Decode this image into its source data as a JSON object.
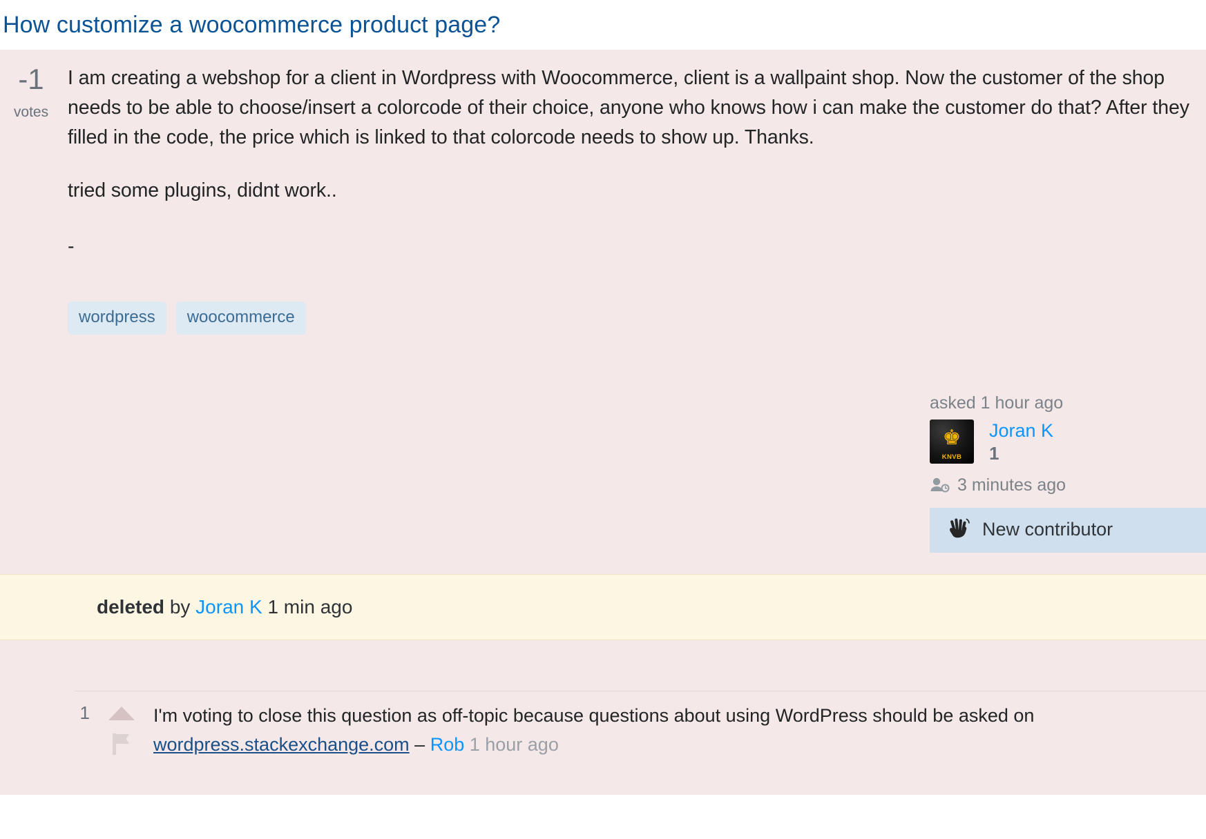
{
  "question": {
    "title": "How customize a woocommerce product page?",
    "votes": "-1",
    "votes_label": "votes",
    "body_paragraphs": [
      "I am creating a webshop for a client in Wordpress with Woocommerce, client is a wallpaint shop. Now the customer of the shop needs to be able to choose/insert a colorcode of their choice, anyone who knows how i can make the customer do that? After they filled in the code, the price which is linked to that colorcode needs to show up. Thanks.",
      "tried some plugins, didnt work..",
      "-"
    ],
    "tags": [
      "wordpress",
      "woocommerce"
    ]
  },
  "user_card": {
    "asked_line": "asked 1 hour ago",
    "avatar_icon": "knvb-lion-avatar",
    "avatar_lion_glyph": "♚",
    "avatar_caption": "KNVB",
    "user_name": "Joran K",
    "reputation": "1",
    "edited_icon": "user-clock-icon",
    "edited_time": "3 minutes ago",
    "badge_icon": "waving-hand-icon",
    "badge_glyph": "🖐",
    "badge_label": "New contributor"
  },
  "deleted_notice": {
    "action": "deleted",
    "by_word": "by",
    "user": "Joran K",
    "time": "1 min ago"
  },
  "comments": [
    {
      "score": "1",
      "upvote_icon": "upvote-triangle-icon",
      "flag_icon": "flag-icon",
      "text_before_link": "I'm voting to close this question as off-topic because questions about using WordPress should be asked on ",
      "link_text": "wordpress.stackexchange.com",
      "separator": " – ",
      "author": "Rob",
      "time": " 1 hour ago"
    }
  ],
  "colors": {
    "post_background": "#f4e8e8",
    "title_link": "#0b5394",
    "tag_background": "#dde9f3",
    "tag_text": "#3c6c93",
    "deleted_background": "#fcf6e3",
    "badge_background": "#cfdfed",
    "user_link": "#0a95ff",
    "muted_text": "#6a737c"
  }
}
